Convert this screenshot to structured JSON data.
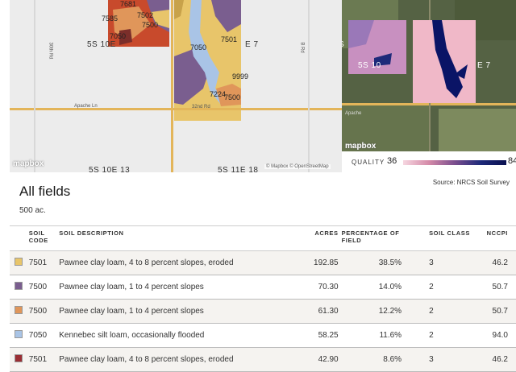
{
  "map_left": {
    "section_labels": [
      "5S 10E",
      "E 7",
      "5S 10E 13",
      "5S 11E 18"
    ],
    "soil_labels": [
      "7681",
      "7585",
      "7502",
      "7500",
      "7050",
      "7050",
      "7501",
      "9999",
      "7224",
      "7500"
    ],
    "road_labels": [
      "30th Rd",
      "B Rd",
      "Apache Ln",
      "32nd Rd"
    ],
    "logo": "mapbox",
    "attribution": "© Mapbox © OpenStreetMap"
  },
  "map_right": {
    "section_labels": [
      "5S",
      "5S 10",
      "E 7"
    ],
    "road_labels": [
      "Apache"
    ],
    "logo": "mapbox"
  },
  "quality": {
    "label": "QUALITY",
    "min": "36",
    "max": "84"
  },
  "source": "Source: NRCS Soil Survey",
  "title": "All fields",
  "area": "500 ac.",
  "table": {
    "headers": {
      "code": "SOIL CODE",
      "desc": "SOIL DESCRIPTION",
      "acres": "ACRES",
      "pct": "PERCENTAGE OF FIELD",
      "class": "SOIL CLASS",
      "nccpi": "NCCPI"
    },
    "rows": [
      {
        "color": "#e8c56a",
        "code": "7501",
        "desc": "Pawnee clay loam, 4 to 8 percent slopes, eroded",
        "acres": "192.85",
        "pct": "38.5%",
        "class": "3",
        "nccpi": "46.2"
      },
      {
        "color": "#7a5e8f",
        "code": "7500",
        "desc": "Pawnee clay loam, 1 to 4 percent slopes",
        "acres": "70.30",
        "pct": "14.0%",
        "class": "2",
        "nccpi": "50.7"
      },
      {
        "color": "#e0965a",
        "code": "7500",
        "desc": "Pawnee clay loam, 1 to 4 percent slopes",
        "acres": "61.30",
        "pct": "12.2%",
        "class": "2",
        "nccpi": "50.7"
      },
      {
        "color": "#a9c4e6",
        "code": "7050",
        "desc": "Kennebec silt loam, occasionally flooded",
        "acres": "58.25",
        "pct": "11.6%",
        "class": "2",
        "nccpi": "94.0"
      },
      {
        "color": "#9a2e34",
        "code": "7501",
        "desc": "Pawnee clay loam, 4 to 8 percent slopes, eroded",
        "acres": "42.90",
        "pct": "8.6%",
        "class": "3",
        "nccpi": "46.2"
      }
    ]
  }
}
